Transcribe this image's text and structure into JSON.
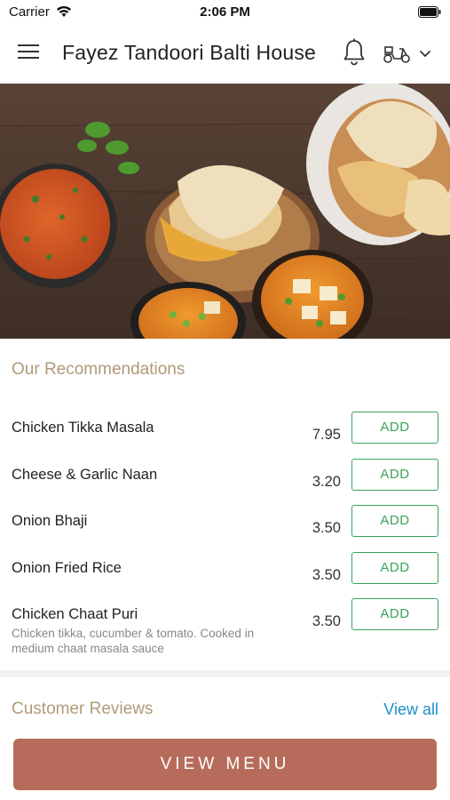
{
  "status_bar": {
    "carrier": "Carrier",
    "time": "2:06 PM"
  },
  "header": {
    "title": "Fayez Tandoori Balti House",
    "icons": [
      "menu-icon",
      "bell-icon",
      "scooter-icon",
      "chevron-down-icon"
    ]
  },
  "hero": {
    "description_icon": "food-photo"
  },
  "recommendations": {
    "title": "Our Recommendations",
    "add_label": "ADD",
    "items": [
      {
        "name": "Chicken Tikka Masala",
        "price": "7.95",
        "description": ""
      },
      {
        "name": "Cheese & Garlic Naan",
        "price": "3.20",
        "description": ""
      },
      {
        "name": "Onion Bhaji",
        "price": "3.50",
        "description": ""
      },
      {
        "name": "Onion Fried Rice",
        "price": "3.50",
        "description": ""
      },
      {
        "name": "Chicken Chaat Puri",
        "price": "3.50",
        "description": "Chicken tikka, cucumber & tomato. Cooked in medium chaat masala sauce"
      }
    ]
  },
  "reviews": {
    "title": "Customer Reviews",
    "view_all_label": "View all"
  },
  "footer": {
    "view_menu_label": "VIEW MENU"
  },
  "colors": {
    "accent_heading": "#b09a78",
    "add_button": "#3aa35a",
    "link": "#1e8fc9",
    "cta": "#b76c5b"
  }
}
